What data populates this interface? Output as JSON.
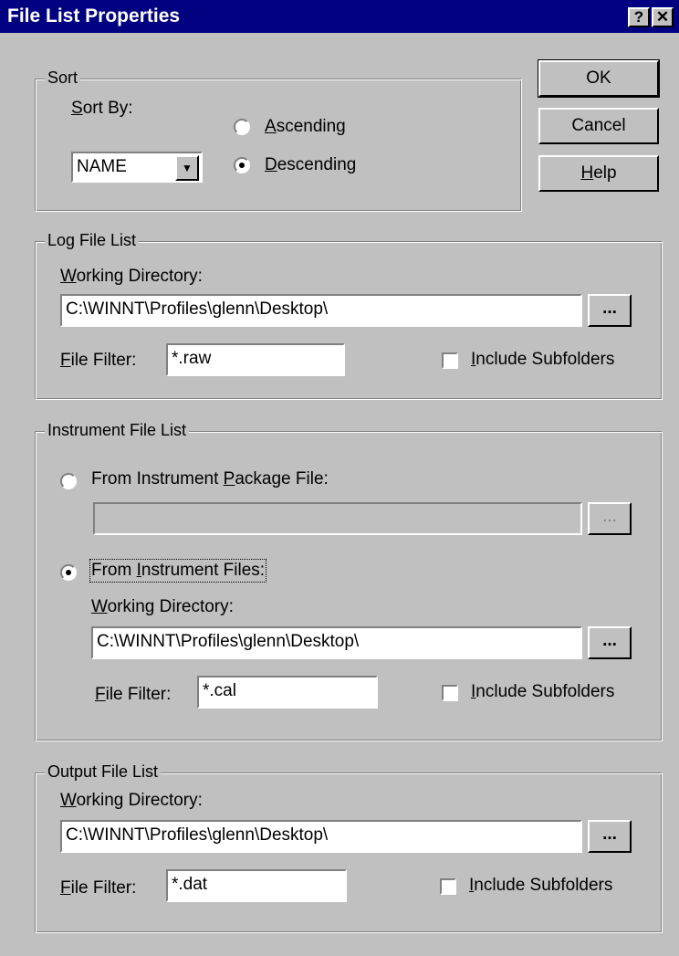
{
  "window": {
    "title": "File List Properties",
    "help_glyph": "?",
    "close_glyph": "✕"
  },
  "buttons": {
    "ok": "OK",
    "cancel": "Cancel",
    "help_prefix": "",
    "help_accel": "H",
    "help_rest": "elp"
  },
  "sort": {
    "legend": "Sort",
    "sort_by_accel": "S",
    "sort_by_rest": "ort By:",
    "value": "NAME",
    "ascending_accel": "A",
    "ascending_rest": "scending",
    "descending_accel": "D",
    "descending_rest": "escending",
    "selected": "descending"
  },
  "log": {
    "legend": "Log File List",
    "wd_accel": "W",
    "wd_rest": "orking Directory:",
    "dir": "C:\\WINNT\\Profiles\\glenn\\Desktop\\",
    "browse": "...",
    "ff_accel": "F",
    "ff_rest": "ile Filter:",
    "filter": "*.raw",
    "inc_accel": "I",
    "inc_rest": "nclude Subfolders"
  },
  "instrument": {
    "legend": "Instrument File List",
    "pkg_prefix": "From Instrument ",
    "pkg_accel": "P",
    "pkg_rest": "ackage File:",
    "pkg_value": "",
    "pkg_browse": "...",
    "files_prefix": "From ",
    "files_accel": "I",
    "files_rest": "nstrument Files:",
    "wd_accel": "W",
    "wd_rest": "orking Directory:",
    "dir": "C:\\WINNT\\Profiles\\glenn\\Desktop\\",
    "browse": "...",
    "ff_accel": "F",
    "ff_rest": "ile Filter:",
    "filter": "*.cal",
    "inc_accel": "I",
    "inc_rest": "nclude Subfolders",
    "selected": "files"
  },
  "output": {
    "legend": "Output File List",
    "wd_accel": "W",
    "wd_rest": "orking Directory:",
    "dir": "C:\\WINNT\\Profiles\\glenn\\Desktop\\",
    "browse": "...",
    "ff_accel": "F",
    "ff_rest": "ile Filter:",
    "filter": "*.dat",
    "inc_accel": "I",
    "inc_rest": "nclude Subfolders"
  },
  "colors": {
    "titlebar": "#000080",
    "face": "#c0c0c0"
  }
}
